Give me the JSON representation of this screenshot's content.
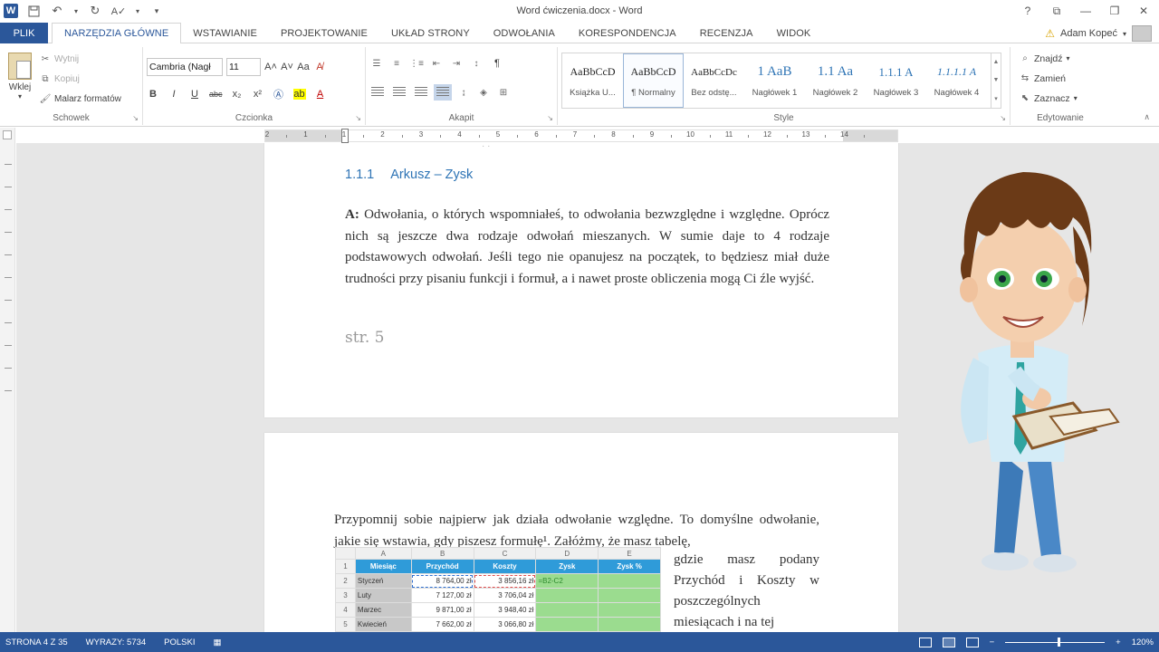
{
  "window": {
    "title": "Word ćwiczenia.docx - Word",
    "controls": [
      "?",
      "⧉",
      "—",
      "❐",
      "✕"
    ]
  },
  "qat": {
    "save_icon": "save-icon",
    "undo_icon": "undo-icon",
    "redo_icon": "redo-icon",
    "spell_icon": "spellcheck-icon",
    "customize_icon": "chevron-down-icon"
  },
  "tabs": {
    "file": "PLIK",
    "items": [
      "NARZĘDZIA GŁÓWNE",
      "WSTAWIANIE",
      "PROJEKTOWANIE",
      "UKŁAD STRONY",
      "ODWOŁANIA",
      "KORESPONDENCJA",
      "RECENZJA",
      "WIDOK"
    ],
    "active_index": 0
  },
  "user": {
    "name": "Adam Kopeć"
  },
  "ribbon": {
    "clipboard": {
      "label": "Schowek",
      "paste": "Wklej",
      "cut": "Wytnij",
      "copy": "Kopiuj",
      "format_painter": "Malarz formatów"
    },
    "font": {
      "label": "Czcionka",
      "font_name": "Cambria (Nagł",
      "font_size": "11",
      "grow": "A˄",
      "shrink": "A˅",
      "case": "Aa",
      "bold": "B",
      "italic": "I",
      "underline": "U",
      "strike": "abc",
      "subscript": "x₂",
      "superscript": "x²"
    },
    "paragraph": {
      "label": "Akapit",
      "pilcrow": "¶"
    },
    "styles": {
      "label": "Style",
      "items": [
        {
          "preview": "AaBbCcD",
          "name": "Książka U..."
        },
        {
          "preview": "AaBbCcD",
          "name": "¶ Normalny"
        },
        {
          "preview": "AaBbCcDc",
          "name": "Bez odstę..."
        },
        {
          "preview": "1",
          "name": "Nagłówek 1"
        },
        {
          "preview": "1.1",
          "name": "Nagłówek 2"
        },
        {
          "preview": "1.1.1",
          "name": "Nagłówek 3"
        },
        {
          "preview": "1.1.1.1",
          "name": "Nagłówek 4"
        }
      ],
      "previews_head": [
        "1  AaB",
        "1.1  Aa",
        "1.1.1  A",
        "1.1.1.1  A"
      ],
      "active_index": 1
    },
    "editing": {
      "label": "Edytowanie",
      "find": "Znajdź",
      "replace": "Zamień",
      "select": "Zaznacz"
    }
  },
  "ruler": {
    "numbers": [
      "2",
      "1",
      "1",
      "2",
      "3",
      "4",
      "5",
      "6",
      "7",
      "8",
      "9",
      "10",
      "11",
      "12",
      "13",
      "14"
    ]
  },
  "document": {
    "page1": {
      "heading_num": "1.1.1",
      "heading_text": "Arkusz – Zysk",
      "para_label": "A:",
      "para_text": "Odwołania, o których wspomniałeś, to odwołania bezwzględne i względne. Oprócz nich są jeszcze dwa rodzaje odwołań mieszanych. W sumie daje to 4 rodzaje podstawowych odwołań. Jeśli tego nie opanujesz na początek, to będziesz miał duże trudności przy pisaniu funkcji i formuł, a i nawet proste obliczenia mogą Ci źle wyjść.",
      "page_label": "str. 5"
    },
    "page2": {
      "para_text": "Przypomnij sobie najpierw jak działa odwołanie względne. To domyślne odwołanie, jakie się wstawia, gdy piszesz formułę¹. Załóżmy, że masz tabelę,",
      "side_text": "gdzie masz podany Przychód i Koszty w poszczególnych miesiącach i na tej"
    },
    "sheet": {
      "col_headers": [
        "A",
        "B",
        "C",
        "D",
        "E"
      ],
      "row_numbers": [
        "1",
        "2",
        "3",
        "4",
        "5"
      ],
      "header": [
        "Miesiąc",
        "Przychód",
        "Koszty",
        "Zysk",
        "Zysk %"
      ],
      "rows": [
        [
          "Styczeń",
          "8 764,00 zł",
          "3 856,16 zł",
          "=B2-C2",
          ""
        ],
        [
          "Luty",
          "7 127,00 zł",
          "3 706,04 zł",
          "",
          ""
        ],
        [
          "Marzec",
          "9 871,00 zł",
          "3 948,40 zł",
          "",
          ""
        ],
        [
          "Kwiecień",
          "7 662,00 zł",
          "3 066,80 zł",
          "",
          ""
        ]
      ]
    }
  },
  "status": {
    "page": "STRONA 4 Z 35",
    "words": "WYRAZY: 5734",
    "language": "POLSKI",
    "zoom": "120%"
  },
  "colors": {
    "accent": "#2b579a",
    "heading": "#2e74b5",
    "sheet_header": "#2f9bd9",
    "sheet_green": "#9bdc8f"
  }
}
